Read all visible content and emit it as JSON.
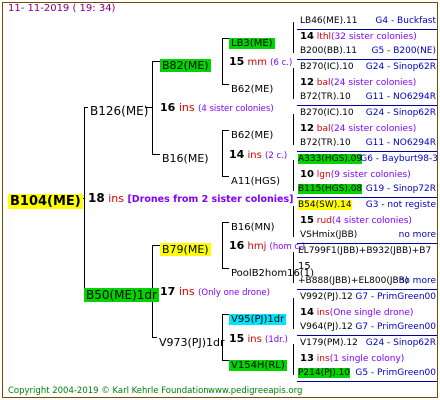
{
  "header": {
    "timestamp": "11- 11-2019 ( 19: 34)"
  },
  "footer": {
    "copyright": "Copyright 2004-2019 © Karl Kehrle Foundation",
    "site": "www.pedigreeapis.org"
  },
  "root": {
    "name": "B104(ME)",
    "count": "18",
    "unit": "ins",
    "note": "[Drones from 2 sister colonies]"
  },
  "dam": {
    "name": "B50(ME)1dr",
    "count": "17",
    "unit": "ins",
    "note": "(Only one drone)"
  },
  "sire": {
    "name": "B126(ME)",
    "count": "16",
    "unit": "ins",
    "note": "(4 sister colonies)"
  },
  "l2": [
    {
      "name": "B82(ME)",
      "count": "15",
      "unit": "mm",
      "note": "(6 c.)"
    },
    {
      "name": "B16(ME)",
      "count": "14",
      "unit": "ins",
      "note": "(2 c.)"
    },
    {
      "name": "B79(ME)",
      "count": "16",
      "unit": "hmj",
      "note": "(hom c.)"
    },
    {
      "name": "V973(PJ)1dr",
      "count": "15",
      "unit": "ins",
      "note": "(1dr.)"
    }
  ],
  "l3": [
    {
      "name": "LB3(ME)",
      "count": "14",
      "unit": "lthl",
      "note": "(32 sister colonies)"
    },
    {
      "name": "B62(ME)",
      "count": "",
      "unit": "",
      "note": ""
    },
    {
      "name": "B62(ME)",
      "count": "12",
      "unit": "bal",
      "note": "(24 sister colonies)"
    },
    {
      "name": "A11(HGS)",
      "count": "10",
      "unit": "lgn",
      "note": "(9 sister colonies)"
    },
    {
      "name": "B16(MN)",
      "count": "15",
      "unit": "rud",
      "note": "(4 sister colonies)"
    },
    {
      "name": "PoolB2hom16(1)",
      "count": "",
      "unit": "",
      "note": ""
    },
    {
      "name": "V95(PJ)1dr",
      "count": "14",
      "unit": "ins",
      "note": "(One single drone)"
    },
    {
      "name": "V154H(RL)",
      "count": "13",
      "unit": "ins",
      "note": "(1 single colony)"
    }
  ],
  "l4": [
    {
      "left": "LB46(ME).11",
      "right": "G4 - Buckfast"
    },
    {
      "left": "",
      "right": ""
    },
    {
      "left": "B200(BB).11",
      "right": "G5 - B200(NE)"
    },
    {
      "left": "B270(IC).10",
      "right": "G24 - Sinop62R"
    },
    {
      "left": "",
      "right": ""
    },
    {
      "left": "B72(TR).10",
      "right": "G11 - NO6294R"
    },
    {
      "left": "B270(IC).10",
      "right": "G24 - Sinop62R"
    },
    {
      "left": "",
      "right": ""
    },
    {
      "left": "B72(TR).10",
      "right": "G11 - NO6294R"
    },
    {
      "left": "A333(HGS).09",
      "right": "G6 - Bayburt98-3"
    },
    {
      "left": "",
      "right": ""
    },
    {
      "left": "B115(HGS).08",
      "right": "G19 - Sinop72R"
    },
    {
      "left": "B54(SW).14",
      "right": "G3 - not registe"
    },
    {
      "left": "",
      "right": ""
    },
    {
      "left": "VSHmix(JBB)",
      "right": "no more"
    },
    {
      "left": "EL799F1(JBB)+B932(JBB)+B7",
      "right": ""
    },
    {
      "left": "15",
      "right": ""
    },
    {
      "left": "+B888(JBB)+EL800(JBB)",
      "right": "no more"
    },
    {
      "left": "V992(PJ).12",
      "right": "G7 - PrimGreen00"
    },
    {
      "left": "",
      "right": ""
    },
    {
      "left": "V964(PJ).12",
      "right": "G7 - PrimGreen00"
    },
    {
      "left": "V179(PM).12",
      "right": "G24 - Sinop62R"
    },
    {
      "left": "",
      "right": ""
    },
    {
      "left": "P214(PJ).10",
      "right": "G5 - PrimGreen00"
    }
  ]
}
